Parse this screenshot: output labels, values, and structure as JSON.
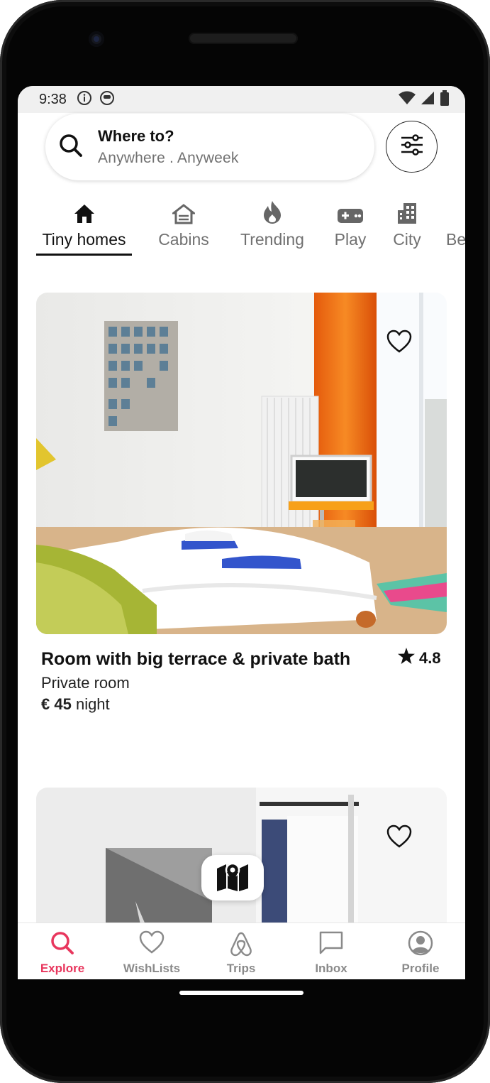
{
  "status_bar": {
    "time": "9:38"
  },
  "search": {
    "title": "Where to?",
    "subtitle": "Anywhere . Anyweek"
  },
  "categories": [
    {
      "label": "Tiny homes",
      "icon": "home-icon",
      "active": true
    },
    {
      "label": "Cabins",
      "icon": "cabin-icon",
      "active": false
    },
    {
      "label": "Trending",
      "icon": "fire-icon",
      "active": false
    },
    {
      "label": "Play",
      "icon": "gamepad-icon",
      "active": false
    },
    {
      "label": "City",
      "icon": "city-icon",
      "active": false
    },
    {
      "label": "Be",
      "icon": "",
      "active": false
    }
  ],
  "listings": [
    {
      "title": "Room with big terrace & private bath",
      "rating": "4.8",
      "type": "Private room",
      "price": "€ 45",
      "price_unit": "night"
    }
  ],
  "bottom_nav": [
    {
      "label": "Explore",
      "icon": "search-icon",
      "active": true
    },
    {
      "label": "WishLists",
      "icon": "heart-icon",
      "active": false
    },
    {
      "label": "Trips",
      "icon": "airbnb-logo-icon",
      "active": false
    },
    {
      "label": "Inbox",
      "icon": "message-icon",
      "active": false
    },
    {
      "label": "Profile",
      "icon": "profile-icon",
      "active": false
    }
  ],
  "colors": {
    "accent": "#e8365d",
    "text": "#111111",
    "muted": "#717171"
  }
}
